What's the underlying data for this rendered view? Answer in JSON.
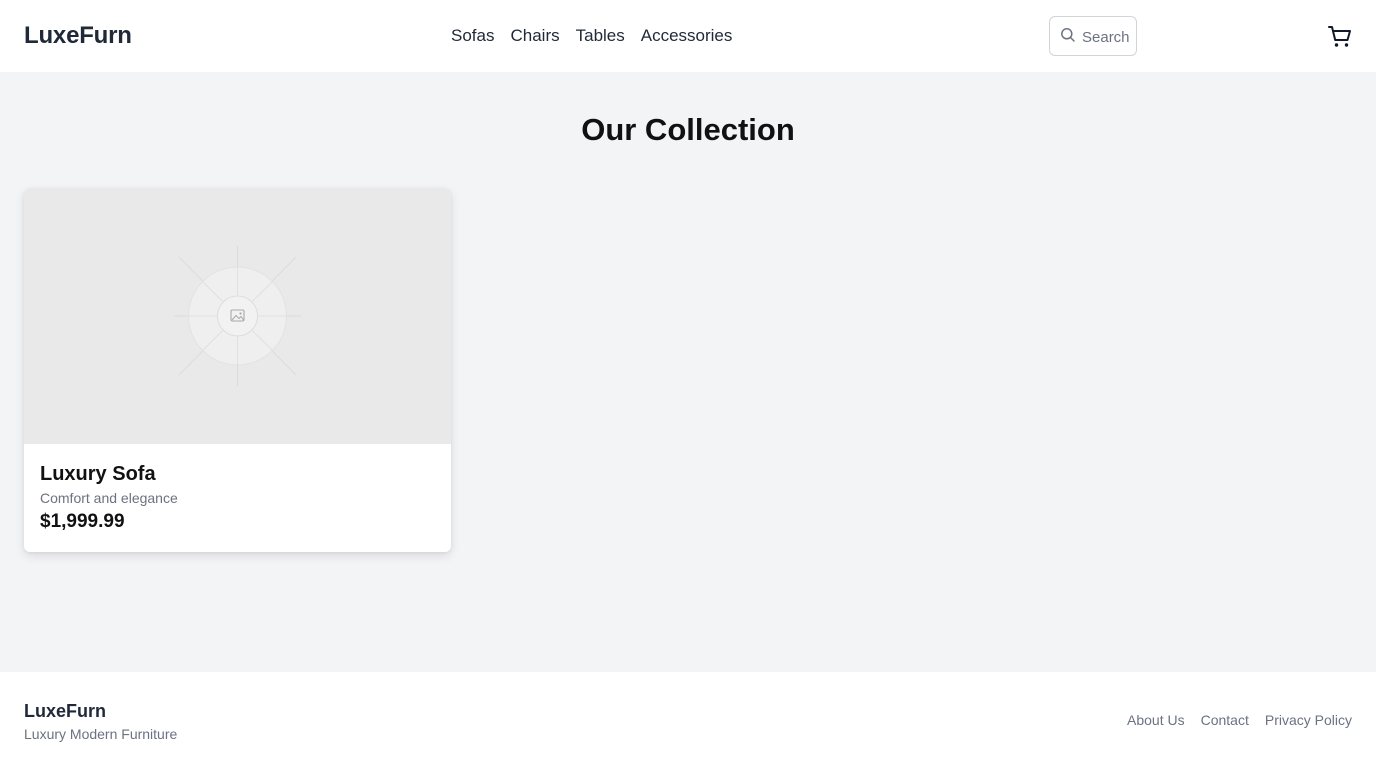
{
  "header": {
    "logo": "LuxeFurn",
    "nav": [
      "Sofas",
      "Chairs",
      "Tables",
      "Accessories"
    ],
    "search_placeholder": "Search",
    "search_icon": "search-icon",
    "cart_icon": "cart-icon"
  },
  "main": {
    "title": "Our Collection",
    "products": [
      {
        "name": "Luxury Sofa",
        "description": "Comfort and elegance",
        "price": "$1,999.99",
        "image_icon": "image-placeholder-icon"
      }
    ]
  },
  "footer": {
    "logo": "LuxeFurn",
    "tagline": "Luxury Modern Furniture",
    "links": [
      "About Us",
      "Contact",
      "Privacy Policy"
    ]
  },
  "colors": {
    "page_background": "#f3f4f6",
    "surface": "#ffffff",
    "text_primary": "#111827",
    "text_muted": "#6b7280",
    "image_placeholder": "#e9e9e9"
  }
}
